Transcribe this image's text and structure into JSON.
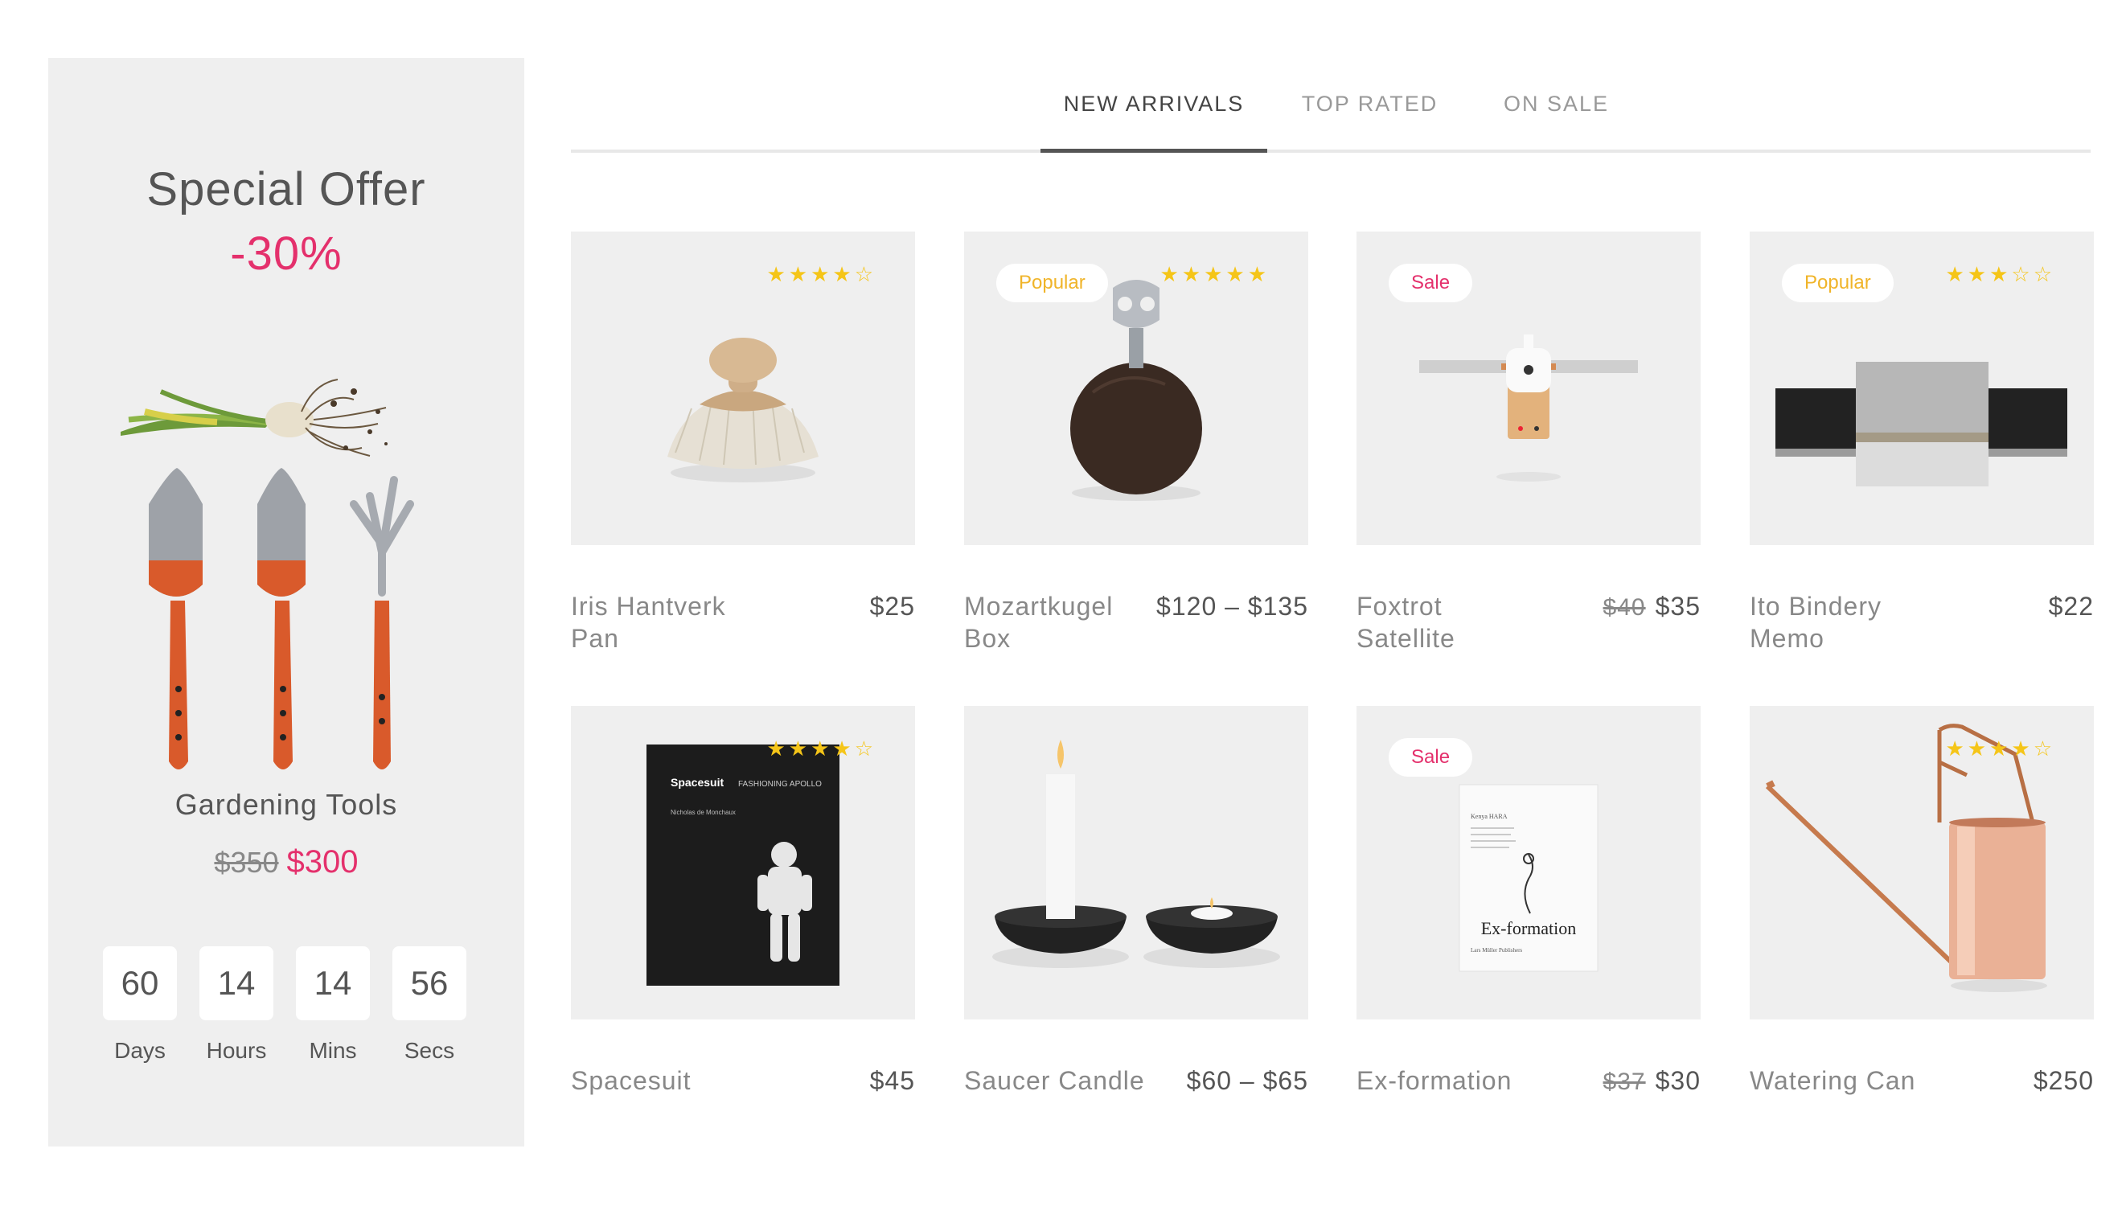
{
  "special_offer": {
    "title": "Special Offer",
    "discount": "-30%",
    "product_name": "Gardening Tools",
    "old_price": "$350",
    "new_price": "$300",
    "countdown": [
      {
        "value": "60",
        "label": "Days"
      },
      {
        "value": "14",
        "label": "Hours"
      },
      {
        "value": "14",
        "label": "Mins"
      },
      {
        "value": "56",
        "label": "Secs"
      }
    ]
  },
  "tabs": [
    {
      "label": "NEW ARRIVALS",
      "active": true
    },
    {
      "label": "TOP RATED",
      "active": false
    },
    {
      "label": "ON SALE",
      "active": false
    }
  ],
  "products": [
    {
      "name": "Iris Hantverk Pan",
      "price": "$25",
      "old_price": "",
      "badge": "",
      "rating": 4
    },
    {
      "name": "Mozartkugel Box",
      "price": "$120 – $135",
      "old_price": "",
      "badge": "Popular",
      "rating": 5
    },
    {
      "name": "Foxtrot Satellite",
      "price": "$35",
      "old_price": "$40",
      "badge": "Sale",
      "rating": 0
    },
    {
      "name": "Ito Bindery Memo",
      "price": "$22",
      "old_price": "",
      "badge": "Popular",
      "rating": 3
    },
    {
      "name": "Spacesuit",
      "price": "$45",
      "old_price": "",
      "badge": "",
      "rating": 4.5
    },
    {
      "name": "Saucer Candle",
      "price": "$60 – $65",
      "old_price": "",
      "badge": "",
      "rating": 0
    },
    {
      "name": "Ex-formation",
      "price": "$30",
      "old_price": "$37",
      "badge": "Sale",
      "rating": 0
    },
    {
      "name": "Watering Can",
      "price": "$250",
      "old_price": "",
      "badge": "",
      "rating": 4.5
    }
  ],
  "book_covers": {
    "spacesuit_title": "Spacesuit",
    "spacesuit_subtitle": "FASHIONING APOLLO",
    "spacesuit_author": "Nicholas de Monchaux",
    "exformation_author": "Kenya HARA",
    "exformation_title": "Ex-formation",
    "exformation_publisher": "Lars Müller Publishers"
  },
  "colors": {
    "accent": "#e4306c",
    "star": "#f5c518",
    "popular": "#f0b429",
    "panel_bg": "#efefef"
  }
}
